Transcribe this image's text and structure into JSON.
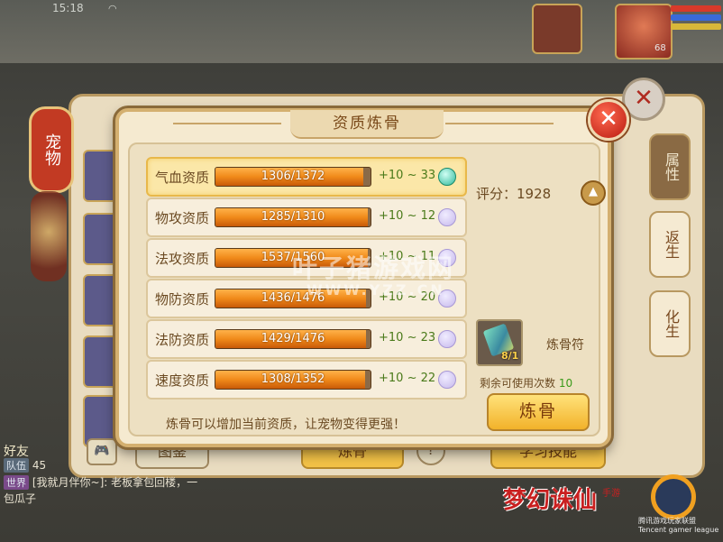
{
  "status": {
    "time": "15:18"
  },
  "scene": {
    "player_level": "68"
  },
  "side_tab": {
    "label": "宠物"
  },
  "right_tabs": [
    {
      "label": "属性"
    },
    {
      "label": "返生"
    },
    {
      "label": "化生"
    }
  ],
  "bottom_buttons": {
    "handbook": "图鉴",
    "refine": "炼骨",
    "learn_skill": "学习技能"
  },
  "chat": {
    "friends_label": "好友",
    "team_tag": "队伍",
    "team_count": "45",
    "world_tag": "世界",
    "world_message": "[我就月伴你~]: 老板拿包回楼，一",
    "last_line": "包瓜子"
  },
  "logo": {
    "game_name": "梦幻诛仙",
    "mobile_mark": "手游",
    "league_text": "腾讯游戏玩家联盟 Tencent gamer league"
  },
  "watermark": {
    "site_cn": "叶子猪游戏网",
    "site_url": "WWW.YZZ.CN"
  },
  "dialog": {
    "title": "资质炼骨",
    "close": "✕",
    "attributes": [
      {
        "label": "气血资质",
        "value": 1306,
        "max": 1372,
        "text": "1306/1372",
        "range": "+10 ~ 33",
        "selected": true
      },
      {
        "label": "物攻资质",
        "value": 1285,
        "max": 1310,
        "text": "1285/1310",
        "range": "+10 ~ 12",
        "selected": false
      },
      {
        "label": "法攻资质",
        "value": 1537,
        "max": 1560,
        "text": "1537/1560",
        "range": "+10 ~ 11",
        "selected": false
      },
      {
        "label": "物防资质",
        "value": 1436,
        "max": 1476,
        "text": "1436/1476",
        "range": "+10 ~ 20",
        "selected": false
      },
      {
        "label": "法防资质",
        "value": 1429,
        "max": 1476,
        "text": "1429/1476",
        "range": "+10 ~ 23",
        "selected": false
      },
      {
        "label": "速度资质",
        "value": 1308,
        "max": 1352,
        "text": "1308/1352",
        "range": "+10 ~ 22",
        "selected": false
      }
    ],
    "score_label": "评分：1928",
    "item_name": "炼骨符",
    "item_count": "8/1",
    "remaining_label": "剩余可使用次数",
    "remaining_count": "10",
    "refine_button": "炼骨",
    "tip": "炼骨可以增加当前资质，让宠物变得更强！"
  }
}
